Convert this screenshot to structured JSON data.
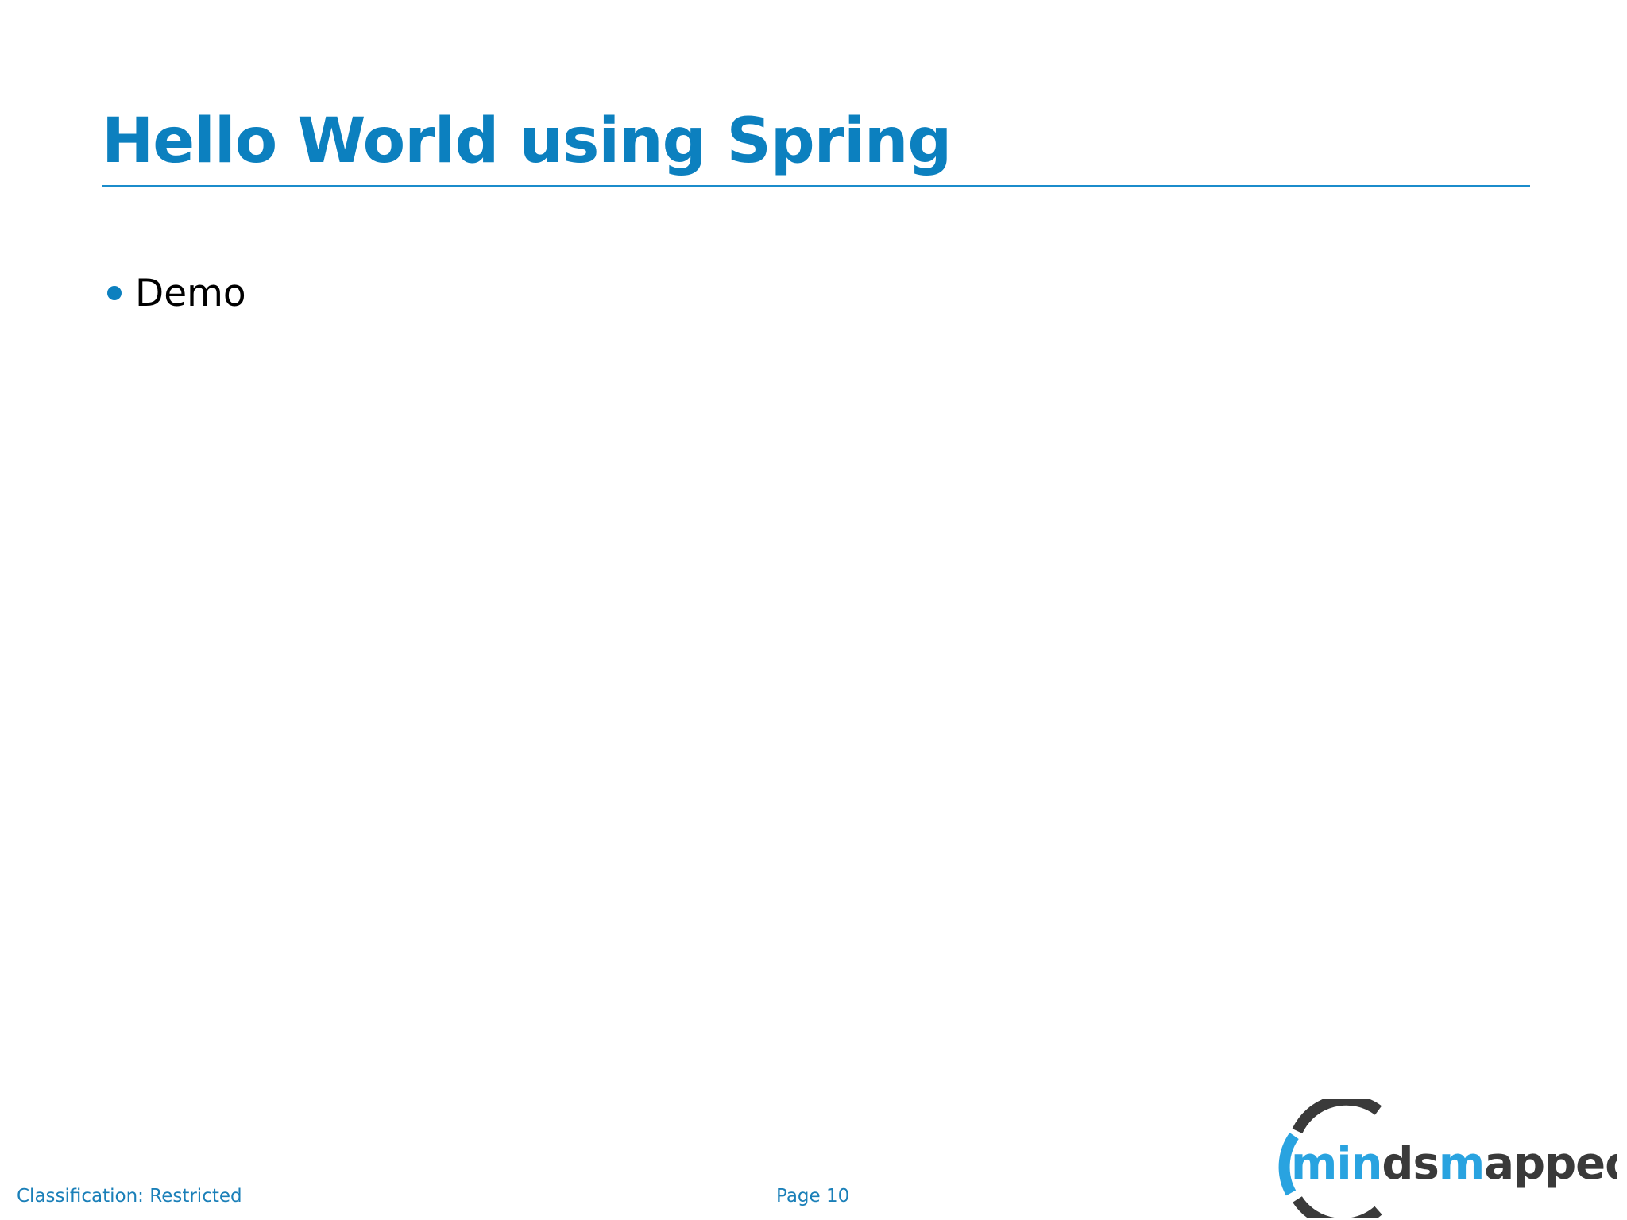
{
  "slide": {
    "title": "Hello World using Spring",
    "bullets": [
      {
        "text": "Demo"
      }
    ]
  },
  "footer": {
    "classification": "Classification: Restricted",
    "page": "Page 10"
  },
  "logo": {
    "text_part1": "min",
    "text_part2": "ds",
    "text_part3": "m",
    "text_part4": "apped",
    "icon": "mindsmapped-logo"
  },
  "colors": {
    "accent": "#0c80bf",
    "rule": "#1b8ccb",
    "footer_text": "#1a7fb8",
    "body_text": "#000000",
    "logo_blue": "#29a3e0",
    "logo_dark": "#3a3a3a"
  }
}
